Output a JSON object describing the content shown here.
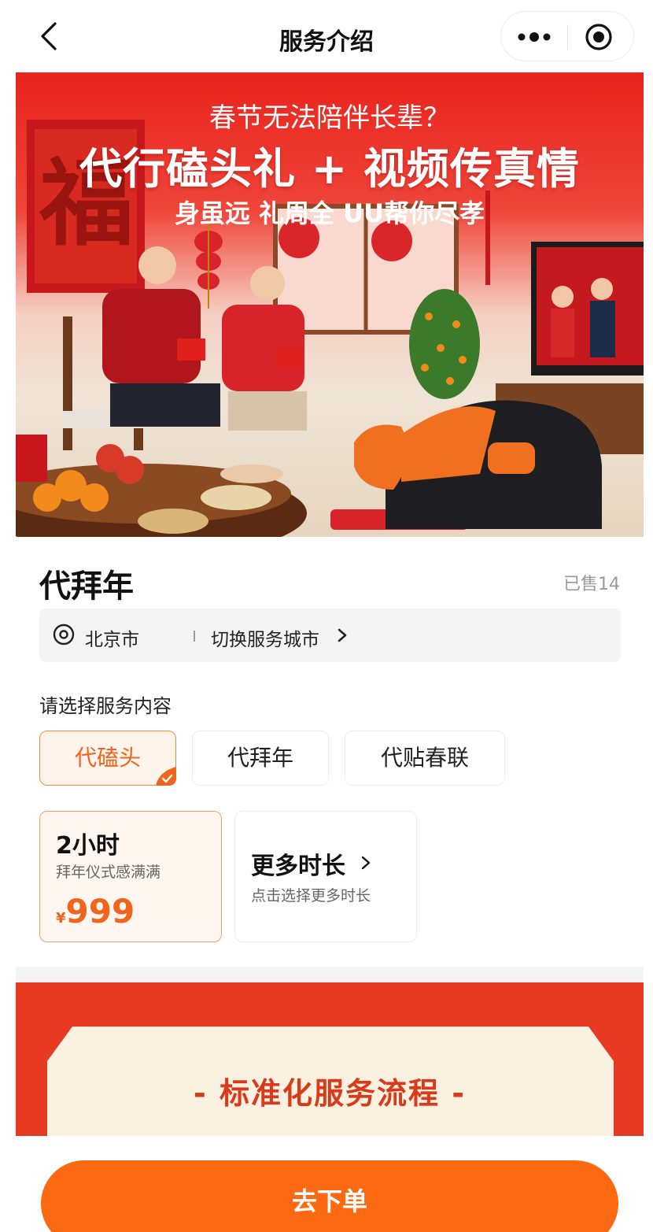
{
  "nav": {
    "title": "服务介绍"
  },
  "banner": {
    "line1": "春节无法陪伴长辈？",
    "line2": "代行磕头礼 + 视频传真情",
    "line3": "身虽远 礼周全 UU帮你尽孝",
    "fu_char": "福"
  },
  "product": {
    "title": "代拜年",
    "sold": "已售14"
  },
  "location": {
    "city": "北京市",
    "switch_label": "切换服务城市"
  },
  "service": {
    "label": "请选择服务内容",
    "options": [
      {
        "label": "代磕头",
        "selected": true
      },
      {
        "label": "代拜年",
        "selected": false
      },
      {
        "label": "代贴春联",
        "selected": false
      }
    ]
  },
  "duration": {
    "selected": {
      "name": "2小时",
      "desc": "拜年仪式感满满",
      "currency": "¥",
      "price": "999"
    },
    "more": {
      "name": "更多时长",
      "desc": "点击选择更多时长"
    }
  },
  "flow": {
    "title": "- 标准化服务流程 -"
  },
  "cta": {
    "label": "去下单"
  },
  "colors": {
    "accent": "#fb6a12",
    "selected_text": "#f0641e",
    "banner_red": "#e8231c"
  }
}
